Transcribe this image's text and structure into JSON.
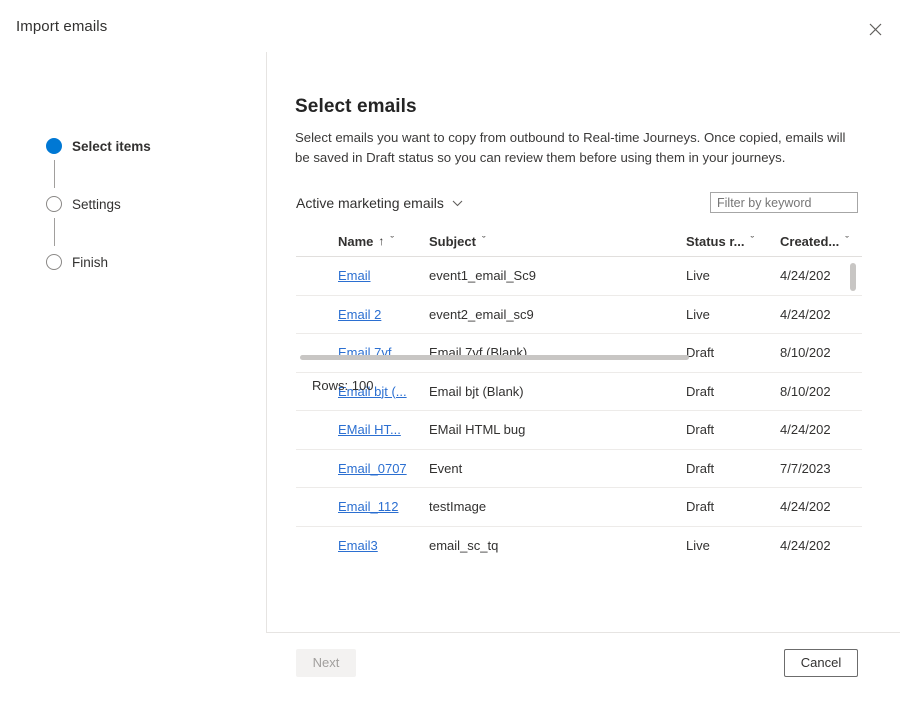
{
  "dialog": {
    "title": "Import emails",
    "close_icon": "close-icon"
  },
  "stepper": {
    "steps": [
      {
        "label": "Select items",
        "state": "active"
      },
      {
        "label": "Settings",
        "state": "inactive"
      },
      {
        "label": "Finish",
        "state": "inactive"
      }
    ]
  },
  "pane": {
    "title": "Select emails",
    "description": "Select emails you want to copy from outbound to Real-time Journeys. Once copied, emails will be saved in Draft status so you can review them before using them in your journeys."
  },
  "toolbar": {
    "view_selector_label": "Active marketing emails",
    "view_selector_chevron": "chevron-down-icon",
    "filter_placeholder": "Filter by keyword",
    "filter_value": ""
  },
  "grid": {
    "columns": [
      {
        "label": "Name",
        "sort": "↑",
        "chevron": "ˇ"
      },
      {
        "label": "Subject",
        "sort": "",
        "chevron": "ˇ"
      },
      {
        "label": "Status r...",
        "sort": "",
        "chevron": "ˇ"
      },
      {
        "label": "Created...",
        "sort": "",
        "chevron": "ˇ"
      }
    ],
    "rows": [
      {
        "name": "Email",
        "subject": "event1_email_Sc9",
        "status": "Live",
        "created": "4/24/202"
      },
      {
        "name": "Email 2",
        "subject": "event2_email_sc9",
        "status": "Live",
        "created": "4/24/202"
      },
      {
        "name": "Email 7vf ...",
        "subject": "Email 7vf (Blank)",
        "status": "Draft",
        "created": "8/10/202"
      },
      {
        "name": "Email bjt (...",
        "subject": "Email bjt (Blank)",
        "status": "Draft",
        "created": "8/10/202"
      },
      {
        "name": "EMail HT...",
        "subject": "EMail HTML bug",
        "status": "Draft",
        "created": "4/24/202"
      },
      {
        "name": "Email_0707",
        "subject": "Event",
        "status": "Draft",
        "created": "7/7/2023"
      },
      {
        "name": "Email_112",
        "subject": "testImage",
        "status": "Draft",
        "created": "4/24/202"
      },
      {
        "name": "Email3",
        "subject": "email_sc_tq",
        "status": "Live",
        "created": "4/24/202"
      }
    ],
    "rows_count_label": "Rows: 100"
  },
  "footer": {
    "next_label": "Next",
    "cancel_label": "Cancel"
  },
  "colors": {
    "accent": "#0078d4",
    "link": "#2b6fd1",
    "text": "#323130",
    "divider": "#e6e4e2",
    "row_divider": "#edebe9",
    "scrollbar": "#c8c6c4",
    "disabled_button_bg": "#f3f2f1"
  }
}
